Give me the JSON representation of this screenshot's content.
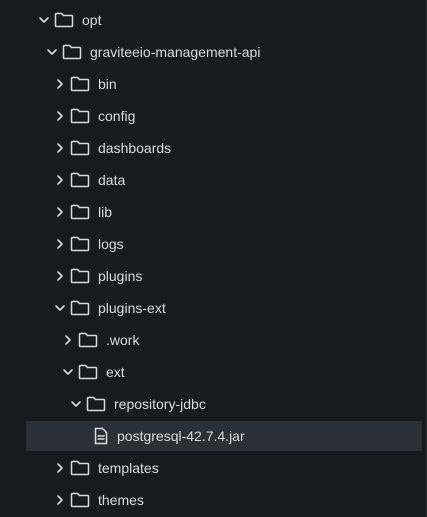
{
  "tree": {
    "items": [
      {
        "label": "opt",
        "type": "folder",
        "expanded": true,
        "chevron": "chevron-down-icon",
        "icon": "folder-icon"
      },
      {
        "label": "graviteeio-management-api",
        "type": "folder",
        "expanded": true,
        "chevron": "chevron-down-icon",
        "icon": "folder-icon"
      },
      {
        "label": "bin",
        "type": "folder",
        "expanded": false,
        "chevron": "chevron-right-icon",
        "icon": "folder-icon"
      },
      {
        "label": "config",
        "type": "folder",
        "expanded": false,
        "chevron": "chevron-right-icon",
        "icon": "folder-icon"
      },
      {
        "label": "dashboards",
        "type": "folder",
        "expanded": false,
        "chevron": "chevron-right-icon",
        "icon": "folder-icon"
      },
      {
        "label": "data",
        "type": "folder",
        "expanded": false,
        "chevron": "chevron-right-icon",
        "icon": "folder-icon"
      },
      {
        "label": "lib",
        "type": "folder",
        "expanded": false,
        "chevron": "chevron-right-icon",
        "icon": "folder-icon"
      },
      {
        "label": "logs",
        "type": "folder",
        "expanded": false,
        "chevron": "chevron-right-icon",
        "icon": "folder-icon"
      },
      {
        "label": "plugins",
        "type": "folder",
        "expanded": false,
        "chevron": "chevron-right-icon",
        "icon": "folder-icon"
      },
      {
        "label": "plugins-ext",
        "type": "folder",
        "expanded": true,
        "chevron": "chevron-down-icon",
        "icon": "folder-icon"
      },
      {
        "label": ".work",
        "type": "folder",
        "expanded": false,
        "chevron": "chevron-right-icon",
        "icon": "folder-icon"
      },
      {
        "label": "ext",
        "type": "folder",
        "expanded": true,
        "chevron": "chevron-down-icon",
        "icon": "folder-icon"
      },
      {
        "label": "repository-jdbc",
        "type": "folder",
        "expanded": true,
        "chevron": "chevron-down-icon",
        "icon": "folder-icon"
      },
      {
        "label": "postgresql-42.7.4.jar",
        "type": "file",
        "selected": true,
        "icon": "file-icon"
      },
      {
        "label": "templates",
        "type": "folder",
        "expanded": false,
        "chevron": "chevron-right-icon",
        "icon": "folder-icon"
      },
      {
        "label": "themes",
        "type": "folder",
        "expanded": false,
        "chevron": "chevron-right-icon",
        "icon": "folder-icon"
      }
    ]
  },
  "colors": {
    "background": "#181a1f",
    "text": "#d8dbe0",
    "selected_row": "#2b3038",
    "icon_stroke": "#d8dbe0"
  }
}
